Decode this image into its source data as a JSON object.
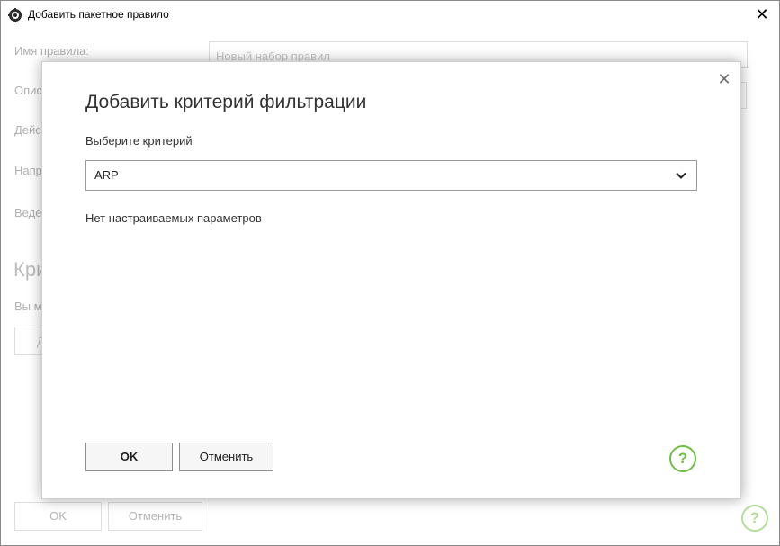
{
  "window": {
    "title": "Добавить пакетное правило",
    "close_glyph": "✕",
    "icon": "gear-app-icon"
  },
  "background": {
    "rule_name_label": "Имя правила:",
    "rule_name_placeholder": "Новый набор правил",
    "description_label_partial": "Опис",
    "action_label_partial": "Дейс",
    "direction_label_partial": "Напр",
    "logging_label_partial": "Веде",
    "criteria_heading_partial": "Кри",
    "criteria_hint_partial": "Вы м",
    "add_button_partial": "Д",
    "ok_label": "OK",
    "cancel_label": "Отменить",
    "help_glyph": "?"
  },
  "dialog": {
    "title": "Добавить критерий фильтрации",
    "close_glyph": "✕",
    "criterion_label": "Выберите критерий",
    "criterion_selected": "ARP",
    "no_params_text": "Нет настраиваемых параметров",
    "ok_label": "OK",
    "cancel_label": "Отменить",
    "help_glyph": "?"
  },
  "colors": {
    "help_green": "#71c043",
    "help_green_faded": "#b4dd9b"
  }
}
